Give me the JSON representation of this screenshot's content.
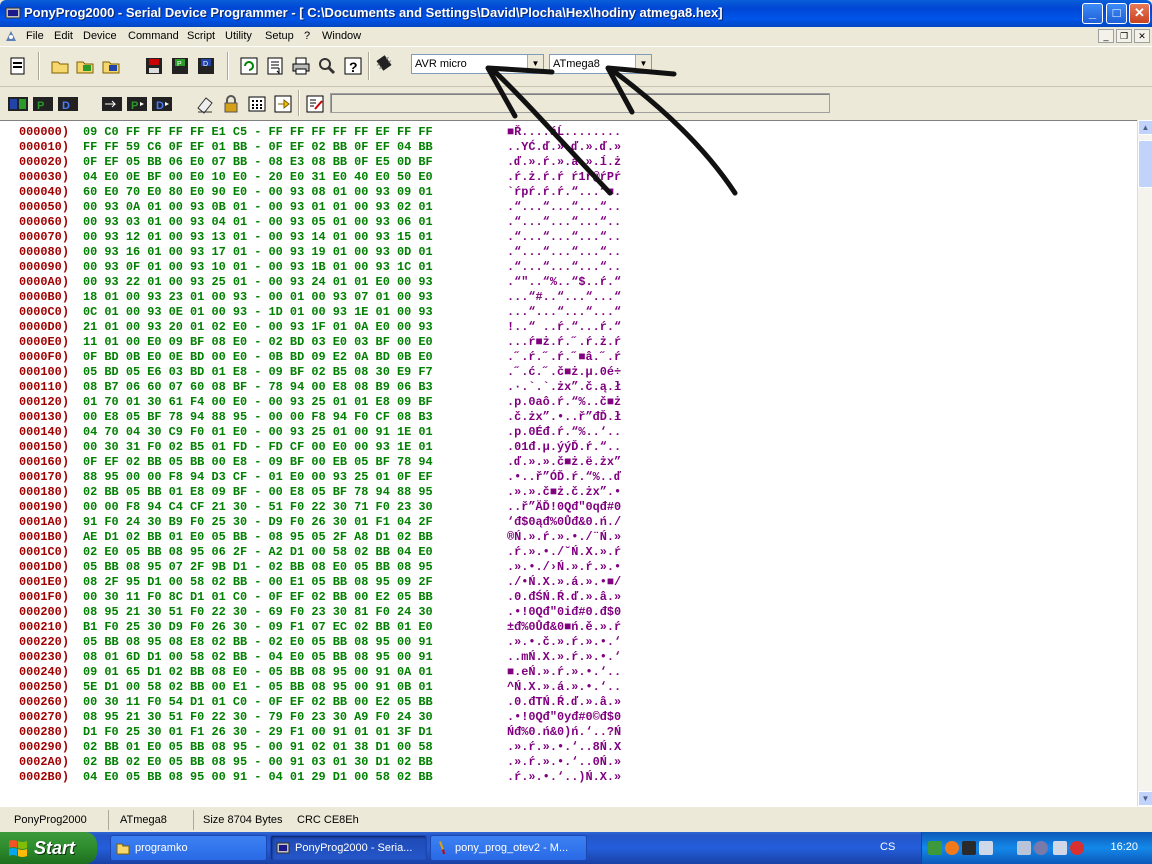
{
  "window": {
    "title": "PonyProg2000 - Serial Device Programmer - [ C:\\Documents and Settings\\David\\Plocha\\Hex\\hodiny atmega8.hex]",
    "minimize": "_",
    "maximize": "□",
    "close": "✕"
  },
  "menu": [
    "File",
    "Edit",
    "Device",
    "Command",
    "Script",
    "Utility",
    "Setup",
    "?",
    "Window"
  ],
  "mdi": {
    "minimize": "_",
    "restore": "❐",
    "close": "✕"
  },
  "toolbar": {
    "family_select": "AVR micro",
    "device_select": "ATmega8",
    "dropdown_arrow": "▼",
    "run_arrow": "➜",
    "icons_row1": [
      "new-file-icon",
      "open-file-icon",
      "open-program-icon",
      "open-data-icon",
      "save-icon",
      "save-program-icon",
      "save-data-icon",
      "reload-icon",
      "edit-buffer-icon",
      "print-icon",
      "setup-icon",
      "help-icon",
      "chip-icon"
    ],
    "icons_row2": [
      "read-all-icon",
      "read-program-icon",
      "read-data-icon",
      "write-all-icon",
      "write-program-icon",
      "write-data-icon",
      "erase-icon",
      "lock-icon",
      "config-bits-icon",
      "program-arrow-icon",
      "script-edit-icon"
    ]
  },
  "hex_dump": [
    [
      "000000)",
      "09 C0 FF FF FF FF E1 C5 - FF FF FF FF FF EF FF FF",
      "■Ř....áĹ........"
    ],
    [
      "000010)",
      "FF FF 59 C6 0F EF 01 BB - 0F EF 02 BB 0F EF 04 BB",
      "..YĆ.ď.».ď.».ď.»"
    ],
    [
      "000020)",
      "0F EF 05 BB 06 E0 07 BB - 08 E3 08 BB 0F E5 0D BF",
      ".ď.».ŕ.».ă.».ĺ.ż"
    ],
    [
      "000030)",
      "04 E0 0E BF 00 E0 10 E0 - 20 E0 31 E0 40 E0 50 E0",
      ".ŕ.ż.ŕ.ŕ ŕ1ŕ@ŕPŕ"
    ],
    [
      "000040)",
      "60 E0 70 E0 80 E0 90 E0 - 00 93 08 01 00 93 09 01",
      "`ŕpŕ.ŕ.ŕ.“...“■."
    ],
    [
      "000050)",
      "00 93 0A 01 00 93 0B 01 - 00 93 01 01 00 93 02 01",
      ".“...“...“...“.."
    ],
    [
      "000060)",
      "00 93 03 01 00 93 04 01 - 00 93 05 01 00 93 06 01",
      ".“...“...“...“.."
    ],
    [
      "000070)",
      "00 93 12 01 00 93 13 01 - 00 93 14 01 00 93 15 01",
      ".“...“...“...“.."
    ],
    [
      "000080)",
      "00 93 16 01 00 93 17 01 - 00 93 19 01 00 93 0D 01",
      ".“...“...“...“.."
    ],
    [
      "000090)",
      "00 93 0F 01 00 93 10 01 - 00 93 1B 01 00 93 1C 01",
      ".“...“...“...“.."
    ],
    [
      "0000A0)",
      "00 93 22 01 00 93 25 01 - 00 93 24 01 01 E0 00 93",
      ".“\"..“%..“$..ŕ.“"
    ],
    [
      "0000B0)",
      "18 01 00 93 23 01 00 93 - 00 01 00 93 07 01 00 93",
      "...“#..“...“...“"
    ],
    [
      "0000C0)",
      "0C 01 00 93 0E 01 00 93 - 1D 01 00 93 1E 01 00 93",
      "...“...“...“...“"
    ],
    [
      "0000D0)",
      "21 01 00 93 20 01 02 E0 - 00 93 1F 01 0A E0 00 93",
      "!..“ ..ŕ.“...ŕ.“"
    ],
    [
      "0000E0)",
      "11 01 00 E0 09 BF 08 E0 - 02 BD 03 E0 03 BF 00 E0",
      "...ŕ■ż.ŕ.˝.ŕ.ż.ŕ"
    ],
    [
      "0000F0)",
      "0F BD 0B E0 0E BD 00 E0 - 0B BD 09 E2 0A BD 0B E0",
      ".˝.ŕ.˝.ŕ.˝■â.˝.ŕ"
    ],
    [
      "000100)",
      "05 BD 05 E6 03 BD 01 E8 - 09 BF 02 B5 08 30 E9 F7",
      ".˝.ć.˝.č■ż.µ.0é÷"
    ],
    [
      "000110)",
      "08 B7 06 60 07 60 08 BF - 78 94 00 E8 08 B9 06 B3",
      ".·.`.`.żx”.č.ą.ł"
    ],
    [
      "000120)",
      "01 70 01 30 61 F4 00 E0 - 00 93 25 01 01 E8 09 BF",
      ".p.0aô.ŕ.“%..č■ż"
    ],
    [
      "000130)",
      "00 E8 05 BF 78 94 88 95 - 00 00 F8 94 F0 CF 08 B3",
      ".č.żx”.•..ř”đĎ.ł"
    ],
    [
      "000140)",
      "04 70 04 30 C9 F0 01 E0 - 00 93 25 01 00 91 1E 01",
      ".p.0Éđ.ŕ.“%..‘.."
    ],
    [
      "000150)",
      "00 30 31 F0 02 B5 01 FD - FD CF 00 E0 00 93 1E 01",
      ".01đ.µ.ýýĎ.ŕ.“.."
    ],
    [
      "000160)",
      "0F EF 02 BB 05 BB 00 E8 - 09 BF 00 EB 05 BF 78 94",
      ".ď.».».č■ż.ë.żx”"
    ],
    [
      "000170)",
      "88 95 00 00 F8 94 D3 CF - 01 E0 00 93 25 01 0F EF",
      ".•..ř”ÓĎ.ŕ.“%..ď"
    ],
    [
      "000180)",
      "02 BB 05 BB 01 E8 09 BF - 00 E8 05 BF 78 94 88 95",
      ".».».č■ż.č.żx”.•"
    ],
    [
      "000190)",
      "00 00 F8 94 C4 CF 21 30 - 51 F0 22 30 71 F0 23 30",
      "..ř”ÄĎ!0Qđ\"0qđ#0"
    ],
    [
      "0001A0)",
      "91 F0 24 30 B9 F0 25 30 - D9 F0 26 30 01 F1 04 2F",
      "‘đ$0ąđ%0Ůđ&0.ń./"
    ],
    [
      "0001B0)",
      "AE D1 02 BB 01 E0 05 BB - 08 95 05 2F A8 D1 02 BB",
      "®Ń.».ŕ.».•./¨Ń.»"
    ],
    [
      "0001C0)",
      "02 E0 05 BB 08 95 06 2F - A2 D1 00 58 02 BB 04 E0",
      ".ŕ.».•./˘Ń.X.».ŕ"
    ],
    [
      "0001D0)",
      "05 BB 08 95 07 2F 9B D1 - 02 BB 08 E0 05 BB 08 95",
      ".».•./›Ń.».ŕ.».•"
    ],
    [
      "0001E0)",
      "08 2F 95 D1 00 58 02 BB - 00 E1 05 BB 08 95 09 2F",
      "./•Ń.X.».á.».•■/"
    ],
    [
      "0001F0)",
      "00 30 11 F0 8C D1 01 C0 - 0F EF 02 BB 00 E2 05 BB",
      ".0.đŚŃ.Ŕ.ď.».â.»"
    ],
    [
      "000200)",
      "08 95 21 30 51 F0 22 30 - 69 F0 23 30 81 F0 24 30",
      ".•!0Qđ\"0iđ#0.đ$0"
    ],
    [
      "000210)",
      "B1 F0 25 30 D9 F0 26 30 - 09 F1 07 EC 02 BB 01 E0",
      "±đ%0Ůđ&0■ń.ě.».ŕ"
    ],
    [
      "000220)",
      "05 BB 08 95 08 E8 02 BB - 02 E0 05 BB 08 95 00 91",
      ".».•.č.».ŕ.».•.‘"
    ],
    [
      "000230)",
      "08 01 6D D1 00 58 02 BB - 04 E0 05 BB 08 95 00 91",
      "..mŃ.X.».ŕ.».•.‘"
    ],
    [
      "000240)",
      "09 01 65 D1 02 BB 08 E0 - 05 BB 08 95 00 91 0A 01",
      "■.eŃ.».ŕ.».•.‘.."
    ],
    [
      "000250)",
      "5E D1 00 58 02 BB 00 E1 - 05 BB 08 95 00 91 0B 01",
      "^Ń.X.».á.».•.‘.."
    ],
    [
      "000260)",
      "00 30 11 F0 54 D1 01 C0 - 0F EF 02 BB 00 E2 05 BB",
      ".0.đTŃ.Ŕ.ď.».â.»"
    ],
    [
      "000270)",
      "08 95 21 30 51 F0 22 30 - 79 F0 23 30 A9 F0 24 30",
      ".•!0Qđ\"0yđ#0©đ$0"
    ],
    [
      "000280)",
      "D1 F0 25 30 01 F1 26 30 - 29 F1 00 91 01 01 3F D1",
      "Ńđ%0.ń&0)ń.‘..?Ń"
    ],
    [
      "000290)",
      "02 BB 01 E0 05 BB 08 95 - 00 91 02 01 38 D1 00 58",
      ".».ŕ.».•.‘..8Ń.X"
    ],
    [
      "0002A0)",
      "02 BB 02 E0 05 BB 08 95 - 00 91 03 01 30 D1 02 BB",
      ".».ŕ.».•.‘..0Ń.»"
    ],
    [
      "0002B0)",
      "04 E0 05 BB 08 95 00 91 - 04 01 29 D1 00 58 02 BB",
      ".ŕ.».•.‘..)Ń.X.»"
    ]
  ],
  "scrollbar": {
    "up": "▲",
    "down": "▼"
  },
  "status": {
    "app": "PonyProg2000",
    "device": "ATmega8",
    "size": "Size  8704 Bytes",
    "crc": "CRC  CE8Eh"
  },
  "taskbar": {
    "start": "Start",
    "tasks": [
      {
        "label": "programko",
        "active": false
      },
      {
        "label": "PonyProg2000 - Seria...",
        "active": true
      },
      {
        "label": "pony_prog_otev2 - M...",
        "active": false
      }
    ],
    "language": "CS",
    "clock": "16:20",
    "tray_icons": [
      "network-icon",
      "antivirus-icon",
      "utility-icon",
      "safely-remove-icon",
      "speaker-icon",
      "bluetooth-icon",
      "network-connection-icon",
      "shield-icon"
    ]
  },
  "colors": {
    "address": "#a00000",
    "hex_bytes": "#008000",
    "ascii": "#800080",
    "titlebar": "#0055ea",
    "taskbar": "#245edb"
  }
}
